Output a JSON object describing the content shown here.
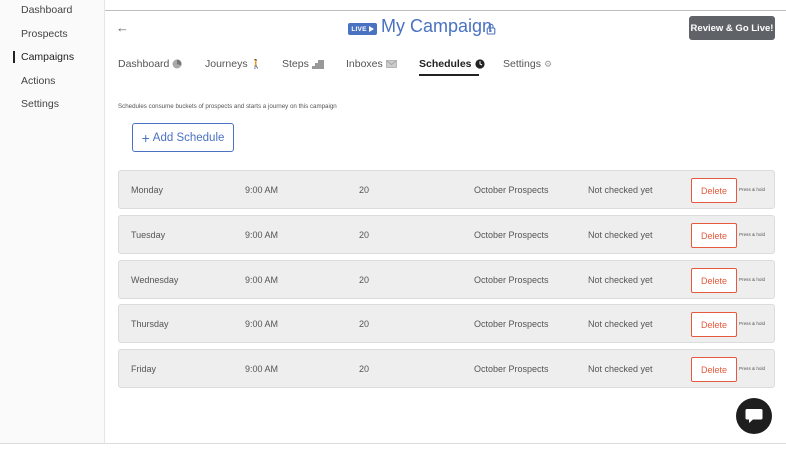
{
  "sidebar": {
    "items": [
      {
        "label": "Dashboard"
      },
      {
        "label": "Prospects"
      },
      {
        "label": "Campaigns",
        "active": true
      },
      {
        "label": "Actions"
      },
      {
        "label": "Settings"
      }
    ]
  },
  "header": {
    "back_label": "←",
    "live_label": "LIVE",
    "campaign_title": "My Campaign",
    "review_button": "Review & Go Live!"
  },
  "tabs": [
    {
      "label": "Dashboard",
      "icon": "chart-icon"
    },
    {
      "label": "Journeys",
      "icon": "person-icon"
    },
    {
      "label": "Steps",
      "icon": "stairs-icon"
    },
    {
      "label": "Inboxes",
      "icon": "envelope-icon"
    },
    {
      "label": "Schedules",
      "icon": "clock-icon",
      "active": true
    },
    {
      "label": "Settings",
      "icon": "gear-icon"
    }
  ],
  "description": "Schedules consume buckets of prospects and starts a journey on this campaign",
  "add_button": {
    "plus": "+",
    "label": "Add Schedule"
  },
  "schedules": {
    "rows": [
      {
        "day": "Monday",
        "time": "9:00 AM",
        "count": "20",
        "list": "October Prospects",
        "status": "Not checked yet"
      },
      {
        "day": "Tuesday",
        "time": "9:00 AM",
        "count": "20",
        "list": "October Prospects",
        "status": "Not checked yet"
      },
      {
        "day": "Wednesday",
        "time": "9:00 AM",
        "count": "20",
        "list": "October Prospects",
        "status": "Not checked yet"
      },
      {
        "day": "Thursday",
        "time": "9:00 AM",
        "count": "20",
        "list": "October Prospects",
        "status": "Not checked yet"
      },
      {
        "day": "Friday",
        "time": "9:00 AM",
        "count": "20",
        "list": "October Prospects",
        "status": "Not checked yet"
      }
    ],
    "delete_label": "Delete",
    "hold_label": "Press & hold"
  },
  "colors": {
    "accent": "#4a72c2",
    "danger": "#e55a3c",
    "review_button_bg": "#5f6368",
    "chat_button_bg": "#1e1e1e"
  }
}
